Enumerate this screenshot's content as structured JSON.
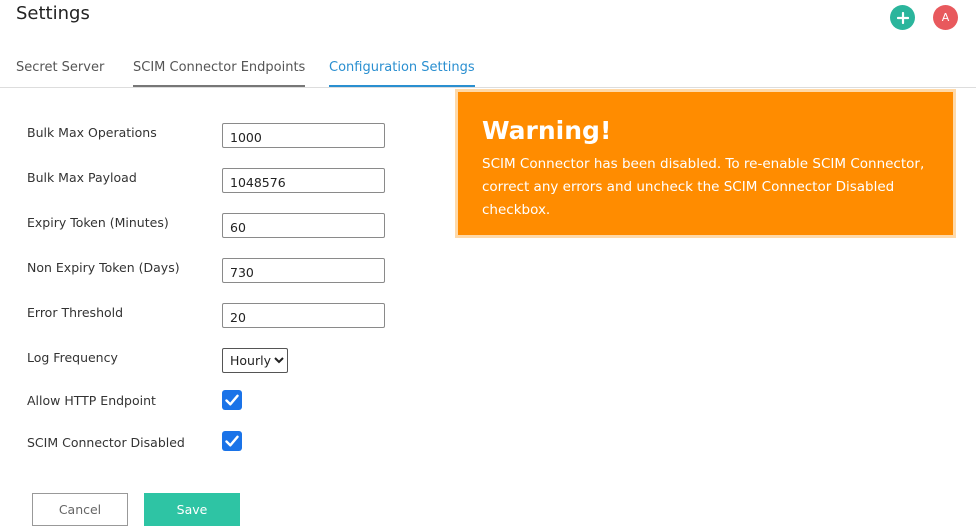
{
  "header": {
    "title": "Settings",
    "add_icon": "plus-icon",
    "avatar_initial": "A",
    "colors": {
      "add": "#2bb59c",
      "avatar": "#e8595d"
    }
  },
  "tabs": [
    {
      "label": "Secret Server",
      "active": false
    },
    {
      "label": "SCIM Connector Endpoints",
      "active": false
    },
    {
      "label": "Configuration Settings",
      "active": true
    }
  ],
  "form": {
    "bulk_max_operations": {
      "label": "Bulk Max Operations",
      "value": "1000"
    },
    "bulk_max_payload": {
      "label": "Bulk Max Payload",
      "value": "1048576"
    },
    "expiry_token": {
      "label": "Expiry Token (Minutes)",
      "value": "60"
    },
    "non_expiry_token": {
      "label": "Non Expiry Token (Days)",
      "value": "730"
    },
    "error_threshold": {
      "label": "Error Threshold",
      "value": "20"
    },
    "log_frequency": {
      "label": "Log Frequency",
      "selected": "Hourly"
    },
    "allow_http": {
      "label": "Allow HTTP Endpoint",
      "checked": true
    },
    "scim_disabled": {
      "label": "SCIM Connector Disabled",
      "checked": true
    }
  },
  "buttons": {
    "cancel": "Cancel",
    "save": "Save"
  },
  "warning": {
    "title": "Warning!",
    "message": "SCIM Connector has been disabled. To re-enable SCIM Connector, correct any errors and uncheck the SCIM Connector Disabled checkbox.",
    "color": "#ff8c00"
  }
}
